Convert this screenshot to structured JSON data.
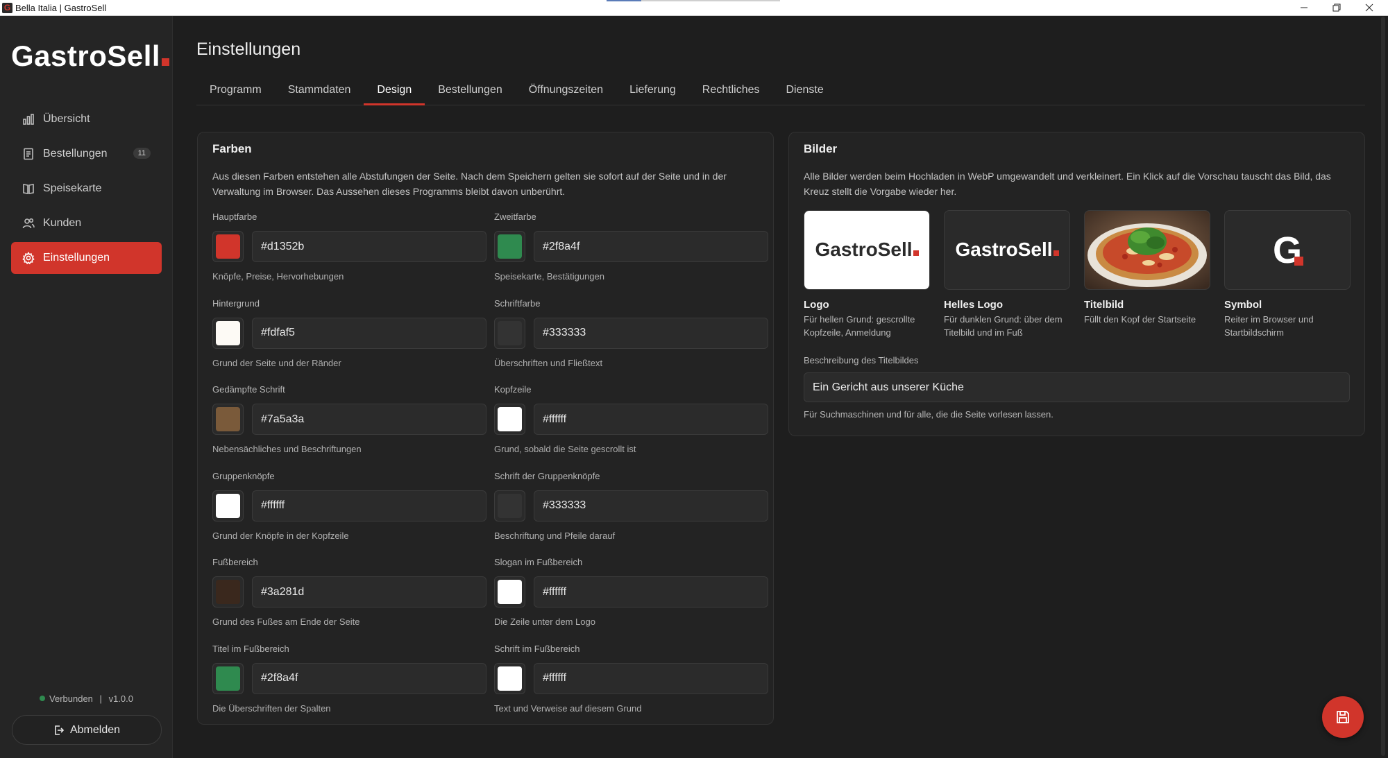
{
  "window": {
    "title": "Bella Italia | GastroSell",
    "app_icon_letter": "G"
  },
  "sidebar": {
    "brand": "GastroSell",
    "items": [
      {
        "label": "Übersicht",
        "icon": "chart-icon"
      },
      {
        "label": "Bestellungen",
        "icon": "receipt-icon",
        "badge": "11"
      },
      {
        "label": "Speisekarte",
        "icon": "book-icon"
      },
      {
        "label": "Kunden",
        "icon": "users-icon"
      },
      {
        "label": "Einstellungen",
        "icon": "gear-icon",
        "active": true
      }
    ],
    "status": {
      "state": "Verbunden",
      "separator": "|",
      "version": "v1.0.0"
    },
    "logout_label": "Abmelden"
  },
  "main": {
    "title": "Einstellungen",
    "tabs": [
      {
        "label": "Programm"
      },
      {
        "label": "Stammdaten"
      },
      {
        "label": "Design",
        "active": true
      },
      {
        "label": "Bestellungen"
      },
      {
        "label": "Öffnungszeiten"
      },
      {
        "label": "Lieferung"
      },
      {
        "label": "Rechtliches"
      },
      {
        "label": "Dienste"
      }
    ]
  },
  "colors_card": {
    "title": "Farben",
    "desc_line1": "Aus diesen Farben entstehen alle Abstufungen der Seite. Nach dem Speichern gelten sie sofort auf der Seite und in der",
    "desc_line2": "Verwaltung im Browser. Das Aussehen dieses Programms bleibt davon unberührt.",
    "fields": [
      {
        "label": "Hauptfarbe",
        "value": "#d1352b",
        "hint": "Knöpfe, Preise, Hervorhebungen"
      },
      {
        "label": "Zweitfarbe",
        "value": "#2f8a4f",
        "hint": "Speisekarte, Bestätigungen"
      },
      {
        "label": "Hintergrund",
        "value": "#fdfaf5",
        "hint": "Grund der Seite und der Ränder"
      },
      {
        "label": "Schriftfarbe",
        "value": "#333333",
        "hint": "Überschriften und Fließtext"
      },
      {
        "label": "Gedämpfte Schrift",
        "value": "#7a5a3a",
        "hint": "Nebensächliches und Beschriftungen"
      },
      {
        "label": "Kopfzeile",
        "value": "#ffffff",
        "hint": "Grund, sobald die Seite gescrollt ist"
      },
      {
        "label": "Gruppenknöpfe",
        "value": "#ffffff",
        "hint": "Grund der Knöpfe in der Kopfzeile"
      },
      {
        "label": "Schrift der Gruppenknöpfe",
        "value": "#333333",
        "hint": "Beschriftung und Pfeile darauf"
      },
      {
        "label": "Fußbereich",
        "value": "#3a281d",
        "hint": "Grund des Fußes am Ende der Seite"
      },
      {
        "label": "Slogan im Fußbereich",
        "value": "#ffffff",
        "hint": "Die Zeile unter dem Logo"
      },
      {
        "label": "Titel im Fußbereich",
        "value": "#2f8a4f",
        "hint": "Die Überschriften der Spalten"
      },
      {
        "label": "Schrift im Fußbereich",
        "value": "#ffffff",
        "hint": "Text und Verweise auf diesem Grund"
      }
    ]
  },
  "images_card": {
    "title": "Bilder",
    "desc_line1": "Alle Bilder werden beim Hochladen in WebP umgewandelt und verkleinert. Ein Klick auf die Vorschau tauscht das Bild, das",
    "desc_line2": "Kreuz stellt die Vorgabe wieder her.",
    "images": [
      {
        "name": "Logo",
        "sub1": "Für hellen Grund: gescrollte",
        "sub2": "Kopfzeile, Anmeldung",
        "logo_text": "GastroSell"
      },
      {
        "name": "Helles Logo",
        "sub1": "Für dunklen Grund: über dem",
        "sub2": "Titelbild und im Fuß",
        "logo_text": "GastroSell"
      },
      {
        "name": "Titelbild",
        "sub1": "Füllt den Kopf der Startseite",
        "sub2": ""
      },
      {
        "name": "Symbol",
        "sub1": "Reiter im Browser und",
        "sub2": "Startbildschirm",
        "logo_text": "G"
      }
    ],
    "alt_label": "Beschreibung des Titelbildes",
    "alt_value": "Ein Gericht aus unserer Küche",
    "alt_hint": "Für Suchmaschinen und für alle, die die Seite vorlesen lassen."
  },
  "theme": {
    "accent": "#d1352b",
    "success": "#2f8a4f",
    "bg": "#1e1e1e"
  }
}
